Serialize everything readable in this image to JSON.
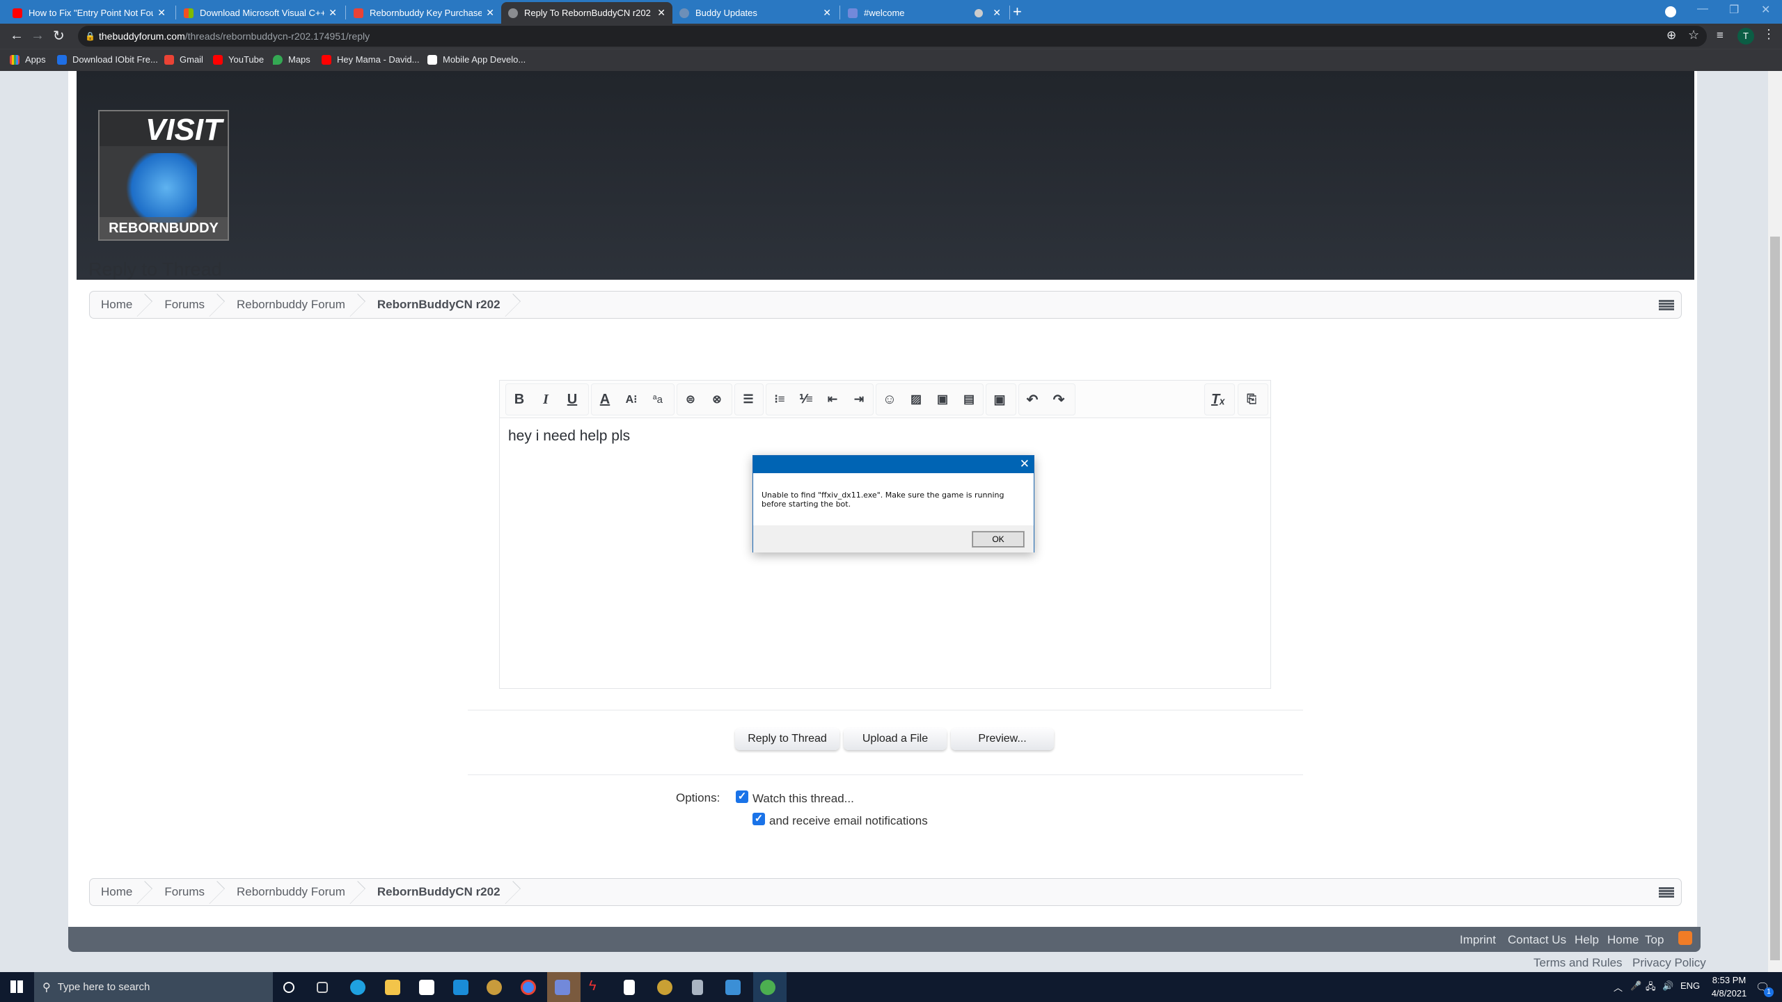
{
  "browser": {
    "tabs": [
      {
        "title": "How to Fix \"Entry Point Not Foun",
        "icon": "youtube-icon",
        "color": "#ff0000"
      },
      {
        "title": "Download Microsoft Visual C++",
        "icon": "microsoft-icon",
        "color": "#7fba00"
      },
      {
        "title": "Rebornbuddy Key Purchase - tob",
        "icon": "gmail-icon",
        "color": "#ea4335"
      },
      {
        "title": "Reply To RebornBuddyCN r202 |",
        "icon": "globe-icon",
        "color": "#8a8c90",
        "active": true
      },
      {
        "title": "Buddy Updates",
        "icon": "globe-icon",
        "color": "#6d8fb8"
      },
      {
        "title": "#welcome",
        "icon": "discord-icon",
        "color": "#7289da"
      }
    ],
    "url_domain": "thebuddyforum.com",
    "url_path": "/threads/rebornbuddycn-r202.174951/reply",
    "profile_initial": "T",
    "bookmarks": [
      {
        "label": "Apps",
        "icon": "apps-grid-icon",
        "color": "#e8453c"
      },
      {
        "label": "Download IObit Fre...",
        "icon": "iobit-icon",
        "color": "#1f6fe5"
      },
      {
        "label": "Gmail",
        "icon": "gmail-icon",
        "color": "#ea4335"
      },
      {
        "label": "YouTube",
        "icon": "youtube-icon",
        "color": "#ff0000"
      },
      {
        "label": "Maps",
        "icon": "maps-icon",
        "color": "#34a853"
      },
      {
        "label": "Hey Mama - David...",
        "icon": "youtube-icon",
        "color": "#ff0000"
      },
      {
        "label": "Mobile App Develo...",
        "icon": "appdev-icon",
        "color": "#ffffff"
      }
    ]
  },
  "logo": {
    "top": "VISIT",
    "bottom": "REBORNBUDDY"
  },
  "breadcrumb": [
    "Home",
    "Forums",
    "Rebornbuddy Forum",
    "RebornBuddyCN r202"
  ],
  "page_title": "Reply to Thread",
  "editor": {
    "text": "hey i need help pls",
    "toolbar_groups": [
      [
        "bold",
        "italic",
        "underline"
      ],
      [
        "font-color",
        "font-size",
        "font-family"
      ],
      [
        "link",
        "unlink"
      ],
      [
        "align"
      ],
      [
        "bulleted-list",
        "numbered-list",
        "outdent",
        "indent"
      ],
      [
        "smilies",
        "image",
        "media",
        "quote"
      ],
      [
        "save-draft"
      ],
      [
        "undo",
        "redo"
      ],
      [
        "remove-formatting"
      ],
      [
        "toggle-bbcode"
      ]
    ]
  },
  "dialog": {
    "message": "Unable to find \"ffxiv_dx11.exe\". Make sure the game is running before starting the bot.",
    "ok_label": "OK"
  },
  "buttons": {
    "reply": "Reply to Thread",
    "upload": "Upload a File",
    "preview": "Preview..."
  },
  "options": {
    "label": "Options:",
    "watch": {
      "label": "Watch this thread...",
      "checked": true
    },
    "email": {
      "label": "and receive email notifications",
      "checked": true
    }
  },
  "footer": {
    "links": [
      "Imprint",
      "Contact Us",
      "Help",
      "Home",
      "Top"
    ],
    "bottom_links": [
      "Terms and Rules",
      "Privacy Policy"
    ]
  },
  "taskbar": {
    "search_placeholder": "Type here to search",
    "time": "8:53 PM",
    "date": "4/8/2021",
    "lang": "ENG",
    "notifications": "1"
  }
}
